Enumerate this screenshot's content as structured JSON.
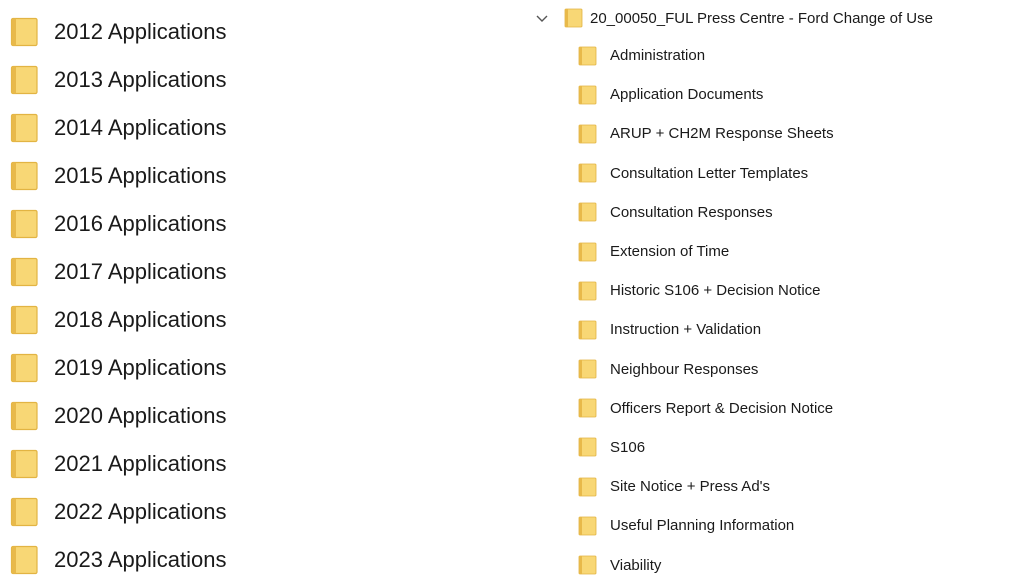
{
  "left_folders": [
    {
      "label": "2012 Applications"
    },
    {
      "label": "2013 Applications"
    },
    {
      "label": "2014 Applications"
    },
    {
      "label": "2015 Applications"
    },
    {
      "label": "2016 Applications"
    },
    {
      "label": "2017 Applications"
    },
    {
      "label": "2018 Applications"
    },
    {
      "label": "2019 Applications"
    },
    {
      "label": "2020 Applications"
    },
    {
      "label": "2021 Applications"
    },
    {
      "label": "2022 Applications"
    },
    {
      "label": "2023 Applications"
    }
  ],
  "tree": {
    "root_label": "20_00050_FUL Press Centre - Ford Change of Use",
    "root_icon": "chevron-down-icon",
    "children": [
      {
        "label": "Administration"
      },
      {
        "label": "Application Documents"
      },
      {
        "label": "ARUP + CH2M Response Sheets"
      },
      {
        "label": "Consultation Letter Templates"
      },
      {
        "label": "Consultation Responses"
      },
      {
        "label": "Extension of Time"
      },
      {
        "label": "Historic S106 + Decision Notice"
      },
      {
        "label": "Instruction + Validation"
      },
      {
        "label": "Neighbour Responses"
      },
      {
        "label": "Officers Report & Decision Notice"
      },
      {
        "label": "S106"
      },
      {
        "label": "Site Notice + Press Ad's"
      },
      {
        "label": "Useful Planning Information"
      },
      {
        "label": "Viability"
      }
    ]
  },
  "colors": {
    "folder_fill": "#f8d775",
    "folder_edge": "#e2b443",
    "text": "#1a1a1a",
    "chevron": "#555555"
  }
}
